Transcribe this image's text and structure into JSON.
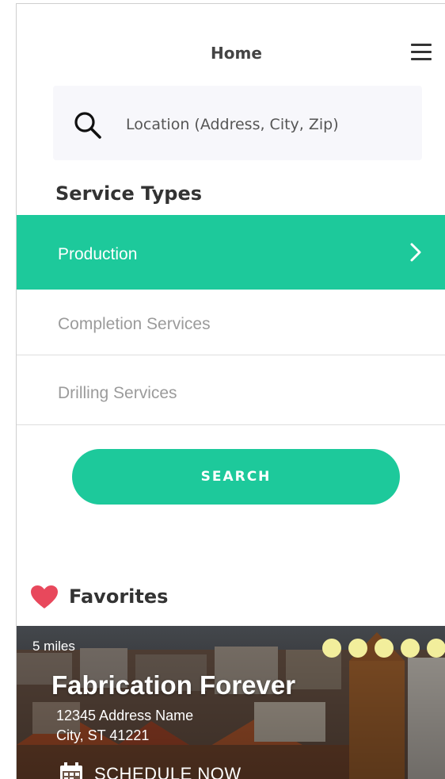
{
  "header": {
    "title": "Home"
  },
  "search": {
    "placeholder": "Location (Address, City, Zip)"
  },
  "services": {
    "title": "Service Types",
    "items": [
      {
        "label": "Production",
        "selected": true
      },
      {
        "label": "Completion Services",
        "selected": false
      },
      {
        "label": "Drilling Services",
        "selected": false
      }
    ]
  },
  "search_button": {
    "label": "SEARCH"
  },
  "favorites": {
    "title": "Favorites",
    "card": {
      "distance": "5 miles",
      "name": "Fabrication Forever",
      "address_line1": "12345 Address Name",
      "address_line2": "City, ST  41221",
      "rating": 5,
      "action_label": "SCHEDULE NOW"
    }
  },
  "colors": {
    "accent": "#1dc99b",
    "heart": "#e8485c",
    "rating_dot": "#f2ee9c",
    "text_dark": "#333333",
    "text_muted": "#9b9b9b"
  },
  "icons": [
    "menu-icon",
    "search-icon",
    "chevron-right-icon",
    "heart-icon",
    "calendar-icon"
  ]
}
